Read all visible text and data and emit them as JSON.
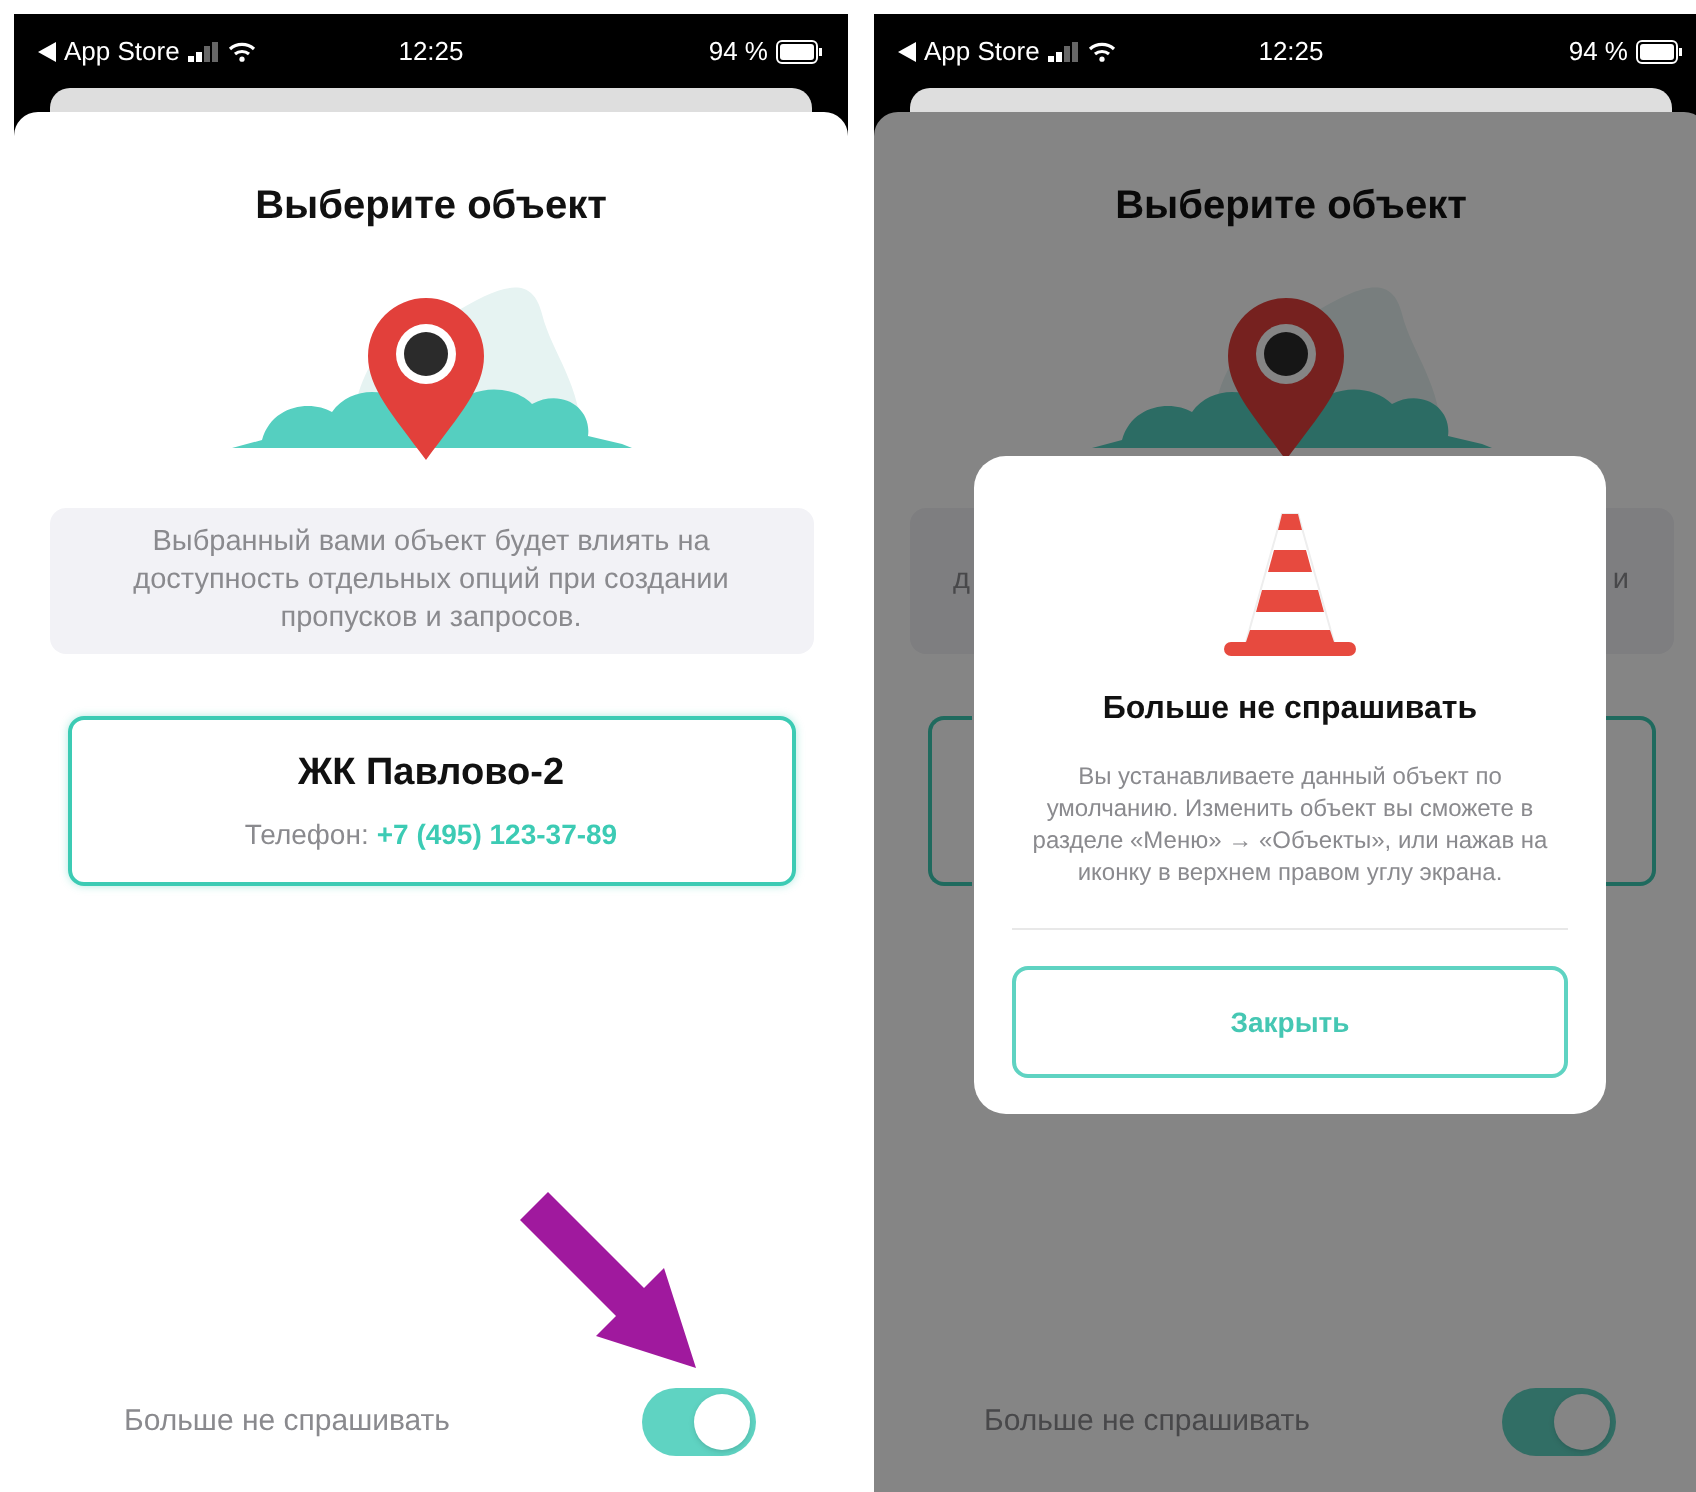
{
  "screens": [
    {
      "dimmed": false,
      "pointer_arrow": true,
      "status_bar": {
        "carrier": "App Store",
        "time": "12:25",
        "battery": "94 %"
      },
      "title": "Выберите объект",
      "info_parts": [
        "Выбранный вами объект будет влиять на доступность отдельных опций при создании пропусков и запросов."
      ],
      "card": {
        "name": "ЖК Павлово-2",
        "phone_label": "Телефон:",
        "phone": "+7 (495) 123-37-89"
      },
      "toggle": {
        "label": "Больше не спрашивать",
        "on": true
      }
    },
    {
      "dimmed": true,
      "status_bar": {
        "carrier": "App Store",
        "time": "12:25",
        "battery": "94 %"
      },
      "title": "Выберите объект",
      "info_parts": [
        "д",
        "и"
      ],
      "toggle": {
        "label": "Больше не спрашивать",
        "on": true
      },
      "dialog": {
        "title": "Больше не спрашивать",
        "text": "Вы устанавливаете данный объект по умолчанию. Изменить объект вы сможете в разделе «Меню» → «Объекты», или нажав на иконку в верхнем правом углу экрана.",
        "button": "Закрыть"
      }
    }
  ]
}
